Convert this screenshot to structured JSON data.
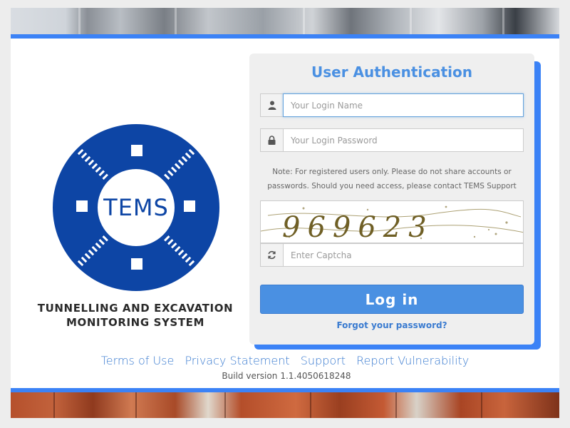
{
  "logo": {
    "text": "TEMS",
    "title_line1": "TUNNELLING AND EXCAVATION",
    "title_line2": "MONITORING SYSTEM",
    "color": "#0d45a5"
  },
  "login": {
    "title": "User Authentication",
    "username_placeholder": "Your Login Name",
    "password_placeholder": "Your Login Password",
    "note": "Note: For registered users only. Please do not share accounts or passwords. Should you need access, please contact TEMS Support",
    "captcha_text": "969623",
    "captcha_placeholder": "Enter Captcha",
    "login_label": "Log in",
    "forgot_label": "Forgot your password?",
    "user_icon": "user-icon",
    "lock_icon": "lock-icon",
    "refresh_icon": "refresh-icon"
  },
  "footer": {
    "links": [
      "Terms of Use",
      "Privacy Statement",
      "Support",
      "Report Vulnerability"
    ],
    "build_label": "Build version",
    "build_version": "1.1.4050618248"
  },
  "colors": {
    "accent": "#3b82f6",
    "button": "#4a90e2",
    "link": "#3a7bd0"
  }
}
